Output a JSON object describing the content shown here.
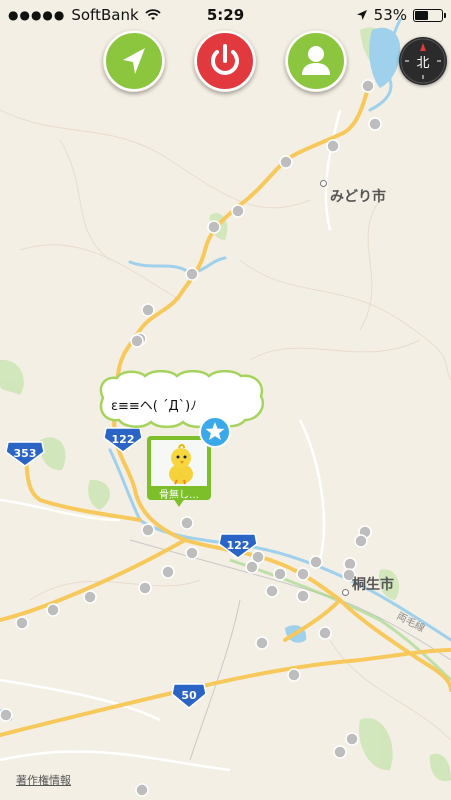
{
  "status_bar": {
    "carrier": "SoftBank",
    "time": "5:29",
    "battery": "53%",
    "battery_level": 0.53,
    "signal_bars": 5
  },
  "toolbar": {
    "navigate_color": "#8cc63f",
    "power_color": "#e2393f",
    "profile_color": "#8cc63f"
  },
  "compass": {
    "label": "北"
  },
  "map": {
    "labels": {
      "midori": "みどり市",
      "kiryu": "桐生市",
      "line": "両毛線"
    },
    "route_shields": [
      "353",
      "122",
      "122",
      "50"
    ]
  },
  "balloon": {
    "text": "ε≡≡ヘ( ´Д`)ﾉ"
  },
  "pin": {
    "label": "骨無し…"
  },
  "attribution": "著作権情報"
}
